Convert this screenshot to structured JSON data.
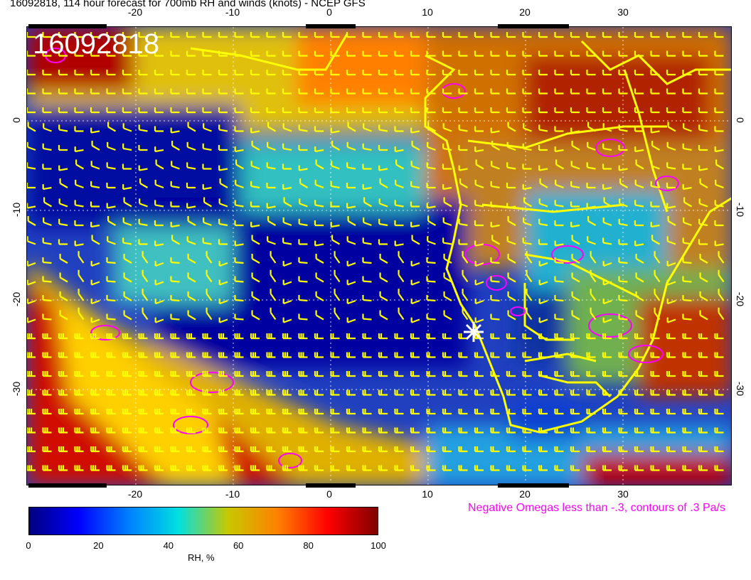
{
  "title": "16092818, 114 hour forecast for 700mb RH and winds (knots) - NCEP GFS",
  "date_stamp": "16092818",
  "map": {
    "lon_ticks": [
      "-20",
      "-10",
      "0",
      "10",
      "20",
      "30"
    ],
    "lat_ticks": [
      "0",
      "-10",
      "-20",
      "-30"
    ],
    "marker_icon": "star-marker-icon"
  },
  "omega_note": "Negative Omegas less than -.3, contours of .3 Pa/s",
  "colorbar": {
    "ticks": [
      "0",
      "20",
      "40",
      "60",
      "80",
      "100"
    ],
    "label": "RH, %",
    "colors": [
      "#00007f",
      "#0000ff",
      "#0080ff",
      "#00e0e0",
      "#c8c800",
      "#ff8000",
      "#ff0000",
      "#7f0000"
    ]
  },
  "colors": {
    "wind_barbs": "#ffff00",
    "coastlines": "#ffff00",
    "omega_contours": "#ff00ff",
    "marker": "#ffffff"
  }
}
